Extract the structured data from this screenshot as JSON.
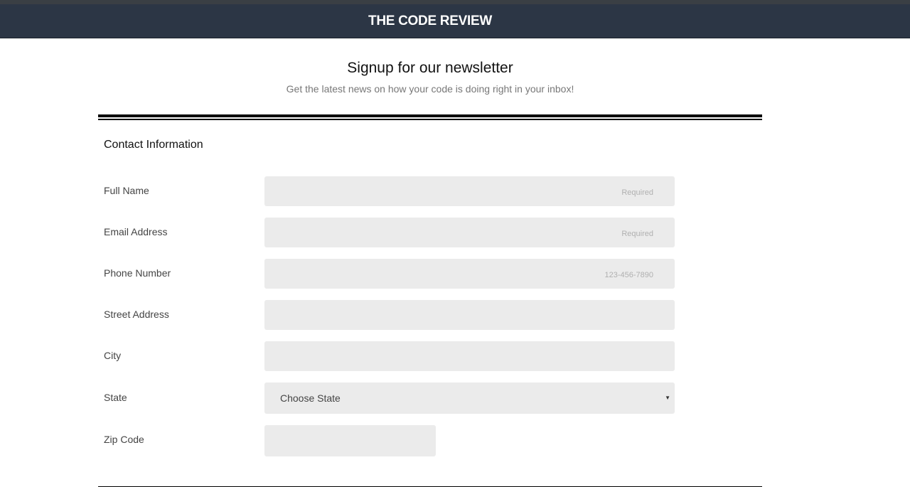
{
  "header": {
    "title": "THE CODE REVIEW"
  },
  "intro": {
    "heading": "Signup for our newsletter",
    "subheading": "Get the latest news on how your code is doing right in your inbox!"
  },
  "form": {
    "section_title": "Contact Information",
    "full_name": {
      "label": "Full Name",
      "placeholder": "Required",
      "value": ""
    },
    "email": {
      "label": "Email Address",
      "placeholder": "Required",
      "value": ""
    },
    "phone": {
      "label": "Phone Number",
      "placeholder": "123-456-7890",
      "value": ""
    },
    "street": {
      "label": "Street Address",
      "placeholder": "",
      "value": ""
    },
    "city": {
      "label": "City",
      "placeholder": "",
      "value": ""
    },
    "state": {
      "label": "State",
      "selected": "Choose State"
    },
    "zip": {
      "label": "Zip Code",
      "placeholder": "",
      "value": ""
    }
  },
  "colors": {
    "header_bg": "#2c3645",
    "field_bg": "#ebebeb"
  },
  "icons": {
    "state_dropdown": "caret-down-icon"
  }
}
